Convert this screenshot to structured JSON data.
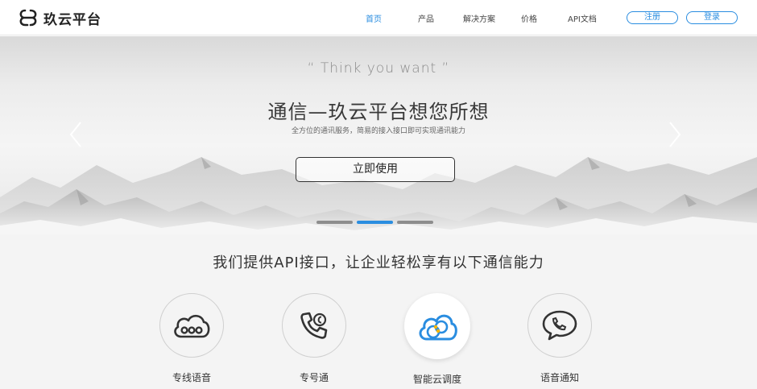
{
  "brand": {
    "name": "玖云平台",
    "accent": "#2a8de0"
  },
  "nav": {
    "items": [
      {
        "label": "首页",
        "active": true
      },
      {
        "label": "产品",
        "active": false
      },
      {
        "label": "解决方案",
        "active": false
      },
      {
        "label": "价格",
        "active": false
      },
      {
        "label": "API文档",
        "active": false
      }
    ],
    "register_label": "注册",
    "login_label": "登录"
  },
  "hero": {
    "tagline": "“ Think you want ”",
    "title": "通信—玖云平台想您所想",
    "subtitle": "全方位的通讯服务，简易的接入接口即可实现通讯能力",
    "cta_label": "立即使用",
    "prev_icon": "chevron-left-icon",
    "next_icon": "chevron-right-icon",
    "slides_total": 3,
    "active_slide": 2
  },
  "services": {
    "title": "我们提供API接口，让企业轻松享有以下通信能力",
    "items": [
      {
        "label": "专线语音",
        "icon": "cloud-voice-icon",
        "active": false
      },
      {
        "label": "专号通",
        "icon": "phone-icon",
        "active": false
      },
      {
        "label": "智能云调度",
        "icon": "cloud-schedule-icon",
        "active": true
      },
      {
        "label": "语音通知",
        "icon": "chat-bubble-icon",
        "active": false
      }
    ]
  }
}
